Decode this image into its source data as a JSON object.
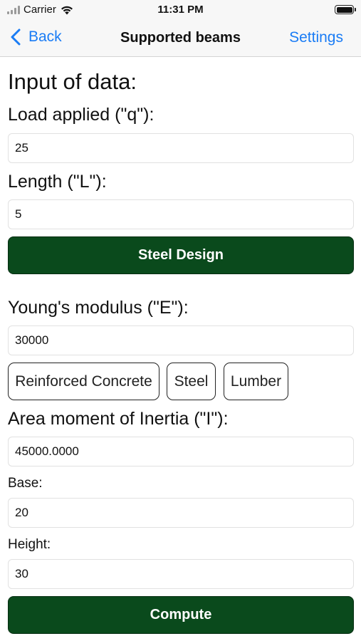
{
  "status_bar": {
    "carrier": "Carrier",
    "time": "11:31 PM"
  },
  "nav": {
    "back_label": "Back",
    "title": "Supported beams",
    "settings_label": "Settings"
  },
  "form": {
    "heading": "Input of data:",
    "load_label": "Load applied (\"q\"):",
    "load_value": "25",
    "length_label": "Length (\"L\"):",
    "length_value": "5",
    "steel_design_label": "Steel Design",
    "youngs_label": "Young's modulus (\"E\"):",
    "youngs_value": "30000",
    "materials": [
      "Reinforced Concrete",
      "Steel",
      "Lumber"
    ],
    "inertia_label": "Area moment of Inertia (\"I\"):",
    "inertia_value": "45000.0000",
    "base_label": "Base:",
    "base_value": "20",
    "height_label": "Height:",
    "height_value": "30",
    "compute_label": "Compute"
  },
  "colors": {
    "accent_blue": "#1a7cf5",
    "button_green": "#0a4a1c"
  }
}
